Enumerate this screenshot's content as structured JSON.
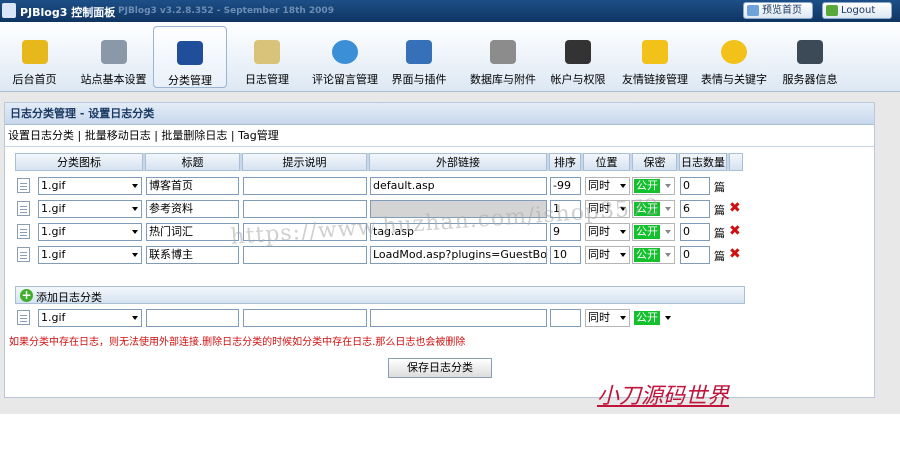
{
  "header": {
    "app_title": "PJBlog3 控制面板",
    "version": "PJBlog3 v3.2.8.352 - September 18th 2009",
    "preview_label": "预览首页",
    "logout_label": "Logout"
  },
  "toolbar": {
    "items": [
      {
        "label": "后台首页",
        "icon": "home-sign-icon"
      },
      {
        "label": "站点基本设置",
        "icon": "gear-icon"
      },
      {
        "label": "分类管理",
        "icon": "books-icon"
      },
      {
        "label": "日志管理",
        "icon": "notepad-icon"
      },
      {
        "label": "评论留言管理",
        "icon": "speech-bubble-icon"
      },
      {
        "label": "界面与插件",
        "icon": "window-icon"
      },
      {
        "label": "数据库与附件",
        "icon": "database-icon"
      },
      {
        "label": "帐户与权限",
        "icon": "users-icon"
      },
      {
        "label": "友情链接管理",
        "icon": "star-icon"
      },
      {
        "label": "表情与关键字",
        "icon": "smiley-icon"
      },
      {
        "label": "服务器信息",
        "icon": "monitor-icon"
      }
    ]
  },
  "panel": {
    "title": "日志分类管理 - 设置日志分类",
    "subnav": [
      "设置日志分类",
      "批量移动日志",
      "批量删除日志",
      "Tag管理"
    ],
    "columns": [
      "分类图标",
      "标题",
      "提示说明",
      "外部链接",
      "排序",
      "位置",
      "保密",
      "日志数量"
    ],
    "rows": [
      {
        "icon": "1.gif",
        "title": "博客首页",
        "desc": "",
        "link": "default.asp",
        "order": "-99",
        "position": "同时",
        "secret": "公开",
        "count": "0",
        "unit": "篇",
        "deletable": false
      },
      {
        "icon": "1.gif",
        "title": "参考资料",
        "desc": "",
        "link": "",
        "order": "1",
        "position": "同时",
        "secret": "公开",
        "count": "6",
        "unit": "篇",
        "deletable": true
      },
      {
        "icon": "1.gif",
        "title": "热门词汇",
        "desc": "",
        "link": "tag.asp",
        "order": "9",
        "position": "同时",
        "secret": "公开",
        "count": "0",
        "unit": "篇",
        "deletable": true
      },
      {
        "icon": "1.gif",
        "title": "联系博主",
        "desc": "",
        "link": "LoadMod.asp?plugins=GuestBo",
        "order": "10",
        "position": "同时",
        "secret": "公开",
        "count": "0",
        "unit": "篇",
        "deletable": true
      }
    ],
    "add_label": "添加日志分类",
    "new_row": {
      "icon": "1.gif",
      "position": "同时",
      "secret": "公开"
    },
    "warning": "如果分类中存在日志，则无法使用外部连接.删除日志分类的时候如分类中存在日志.那么日志也会被删除",
    "save_label": "保存日志分类"
  },
  "watermark": "https://www.huzhan.com/ishop3572",
  "signature": "小刀源码世界",
  "colors": {
    "header": "#1d4f87",
    "public_badge": "#12c12b",
    "delete": "#d01010",
    "warning": "#d01010",
    "signature": "#c0143c"
  }
}
